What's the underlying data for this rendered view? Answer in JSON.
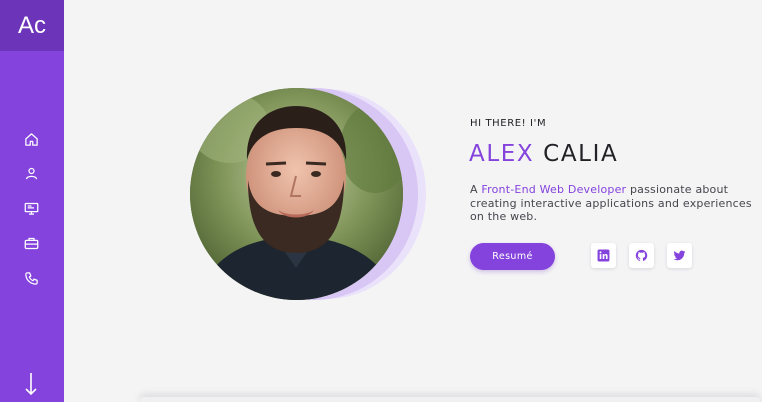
{
  "sidebar": {
    "logo": "Ac",
    "bg_color": "#8443dc",
    "logo_bg_color": "#6c34b8",
    "nav": [
      {
        "icon": "home-icon"
      },
      {
        "icon": "user-icon"
      },
      {
        "icon": "monitor-icon"
      },
      {
        "icon": "briefcase-icon"
      },
      {
        "icon": "phone-icon"
      }
    ],
    "scroll_icon": "arrow-down-icon"
  },
  "hero": {
    "greeting": "HI THERE! I'M",
    "first_name": "ALEX",
    "last_name": "CALIA",
    "bio_prefix": "A ",
    "bio_highlight": "Front-End Web Developer",
    "bio_suffix": " passionate about creating interactive applications and experiences on the web.",
    "resume_label": "Resumé",
    "accent_color": "#8443dc",
    "socials": [
      {
        "icon": "linkedin-icon"
      },
      {
        "icon": "github-icon"
      },
      {
        "icon": "twitter-icon"
      }
    ]
  }
}
